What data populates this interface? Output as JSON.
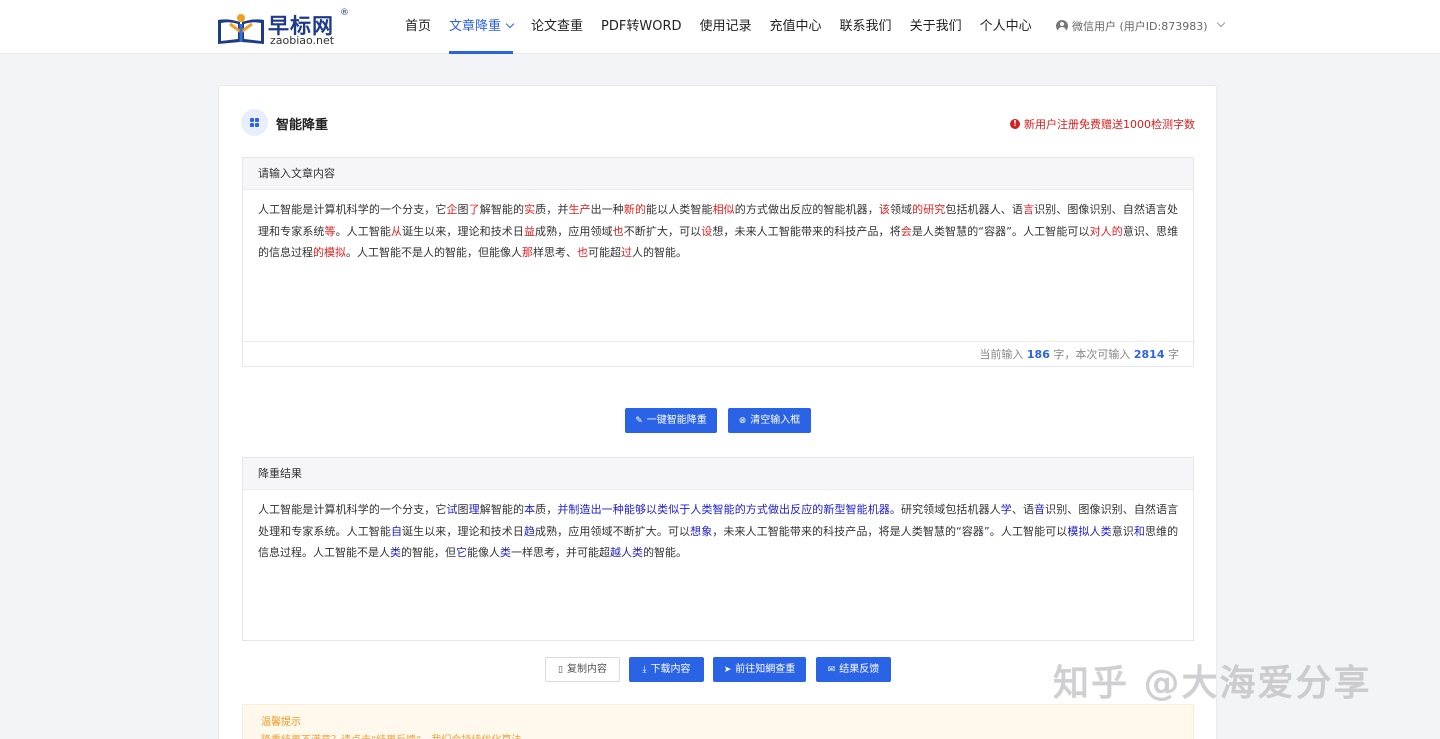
{
  "brand": {
    "name_cn": "早标网",
    "name_en": "zaobiao.net",
    "reg_mark": "®"
  },
  "nav": {
    "items": [
      {
        "label": "首页"
      },
      {
        "label": "文章降重",
        "active": true,
        "dropdown": true
      },
      {
        "label": "论文查重"
      },
      {
        "label": "PDF转WORD"
      },
      {
        "label": "使用记录"
      },
      {
        "label": "充值中心"
      },
      {
        "label": "联系我们"
      },
      {
        "label": "关于我们"
      },
      {
        "label": "个人中心"
      }
    ]
  },
  "user": {
    "label": "微信用户 (用户ID:873983)"
  },
  "tool": {
    "title": "智能降重",
    "promo": "新用户注册免费赠送1000检测字数",
    "promo_color": "#d42020",
    "accent_color": "#2b63e6"
  },
  "input": {
    "header": "请输入文章内容",
    "segments": [
      [
        "人工智能是计算机科学的一个分支，它",
        0
      ],
      [
        "企",
        1
      ],
      [
        "图",
        0
      ],
      [
        "了",
        1
      ],
      [
        "解智能的",
        0
      ],
      [
        "实",
        1
      ],
      [
        "质，并",
        0
      ],
      [
        "生产",
        1
      ],
      [
        "出一种",
        0
      ],
      [
        "新的",
        1
      ],
      [
        "能以人类智能",
        0
      ],
      [
        "相似",
        1
      ],
      [
        "的方式做出反应的智能机器，",
        0
      ],
      [
        "该",
        1
      ],
      [
        "领域",
        0
      ],
      [
        "的研究",
        1
      ],
      [
        "包括机器人、语",
        0
      ],
      [
        "言",
        1
      ],
      [
        "识别、图像识别、自然语言处理和专家系统",
        0
      ],
      [
        "等",
        1
      ],
      [
        "。人工智能",
        0
      ],
      [
        "从",
        1
      ],
      [
        "诞生以来，理论和技术日",
        0
      ],
      [
        "益",
        1
      ],
      [
        "成熟，应用领域",
        0
      ],
      [
        "也",
        1
      ],
      [
        "不断扩大，可以",
        0
      ],
      [
        "设",
        1
      ],
      [
        "想，未来人工智能带来的科技产品，将",
        0
      ],
      [
        "会",
        1
      ],
      [
        "是人类智慧的“容器”。人工智能可以",
        0
      ],
      [
        "对人的",
        1
      ],
      [
        "意识、思维的信息过程",
        0
      ],
      [
        "的模拟",
        1
      ],
      [
        "。人工智能不是人的智能，但能像人",
        0
      ],
      [
        "那",
        1
      ],
      [
        "样思考、",
        0
      ],
      [
        "也",
        1
      ],
      [
        "可能超",
        0
      ],
      [
        "过",
        1
      ],
      [
        "人的智能。",
        0
      ]
    ],
    "counter_prefix": "当前输入",
    "current_count": "186",
    "counter_mid": "字，本次可输入",
    "max_count": "2814",
    "counter_suffix": "字"
  },
  "actions": {
    "rewrite_label": "一键智能降重",
    "clear_label": "清空输入框"
  },
  "result": {
    "header": "降重结果",
    "segments": [
      [
        "人工智能是计算机科学的一个分支，它",
        0
      ],
      [
        "试",
        2
      ],
      [
        "图",
        0
      ],
      [
        "理",
        2
      ],
      [
        "解智能的",
        0
      ],
      [
        "本",
        2
      ],
      [
        "质，",
        0
      ],
      [
        "并制造出一种能够以类似于人类智能的方式做出反应的新型智能机器。",
        2
      ],
      [
        "研究领域包括机器人",
        0
      ],
      [
        "学",
        2
      ],
      [
        "、语",
        0
      ],
      [
        "音",
        2
      ],
      [
        "识别、图像识别、自然语言处理和专家系统。人工智能",
        0
      ],
      [
        "自",
        2
      ],
      [
        "诞生以来，理论和技术日",
        0
      ],
      [
        "趋",
        2
      ],
      [
        "成熟，应用领域不断扩大。可以",
        0
      ],
      [
        "想象",
        2
      ],
      [
        "，未来人工智能带来的科技产品，将是人类智慧的“容器”",
        0
      ],
      [
        "。",
        2
      ],
      [
        "人工智能可以",
        0
      ],
      [
        "模拟人类",
        2
      ],
      [
        "意识",
        0
      ],
      [
        "和",
        2
      ],
      [
        "思维的信息过程。人工智能不是人",
        0
      ],
      [
        "类",
        2
      ],
      [
        "的智能，但",
        0
      ],
      [
        "它",
        2
      ],
      [
        "能像人",
        0
      ],
      [
        "类",
        2
      ],
      [
        "一样思考，并可能超",
        0
      ],
      [
        "越人类",
        2
      ],
      [
        "的智能。",
        0
      ]
    ],
    "copy_label": "复制内容",
    "download_label": "下载内容",
    "check_label": "前往知網查重",
    "feedback_label": "结果反馈"
  },
  "notice": {
    "title": "温馨提示",
    "line": "降重结果不满意？请点击“结果反馈”，我们会持续优化算法"
  },
  "watermark": "知乎 @大海爱分享"
}
